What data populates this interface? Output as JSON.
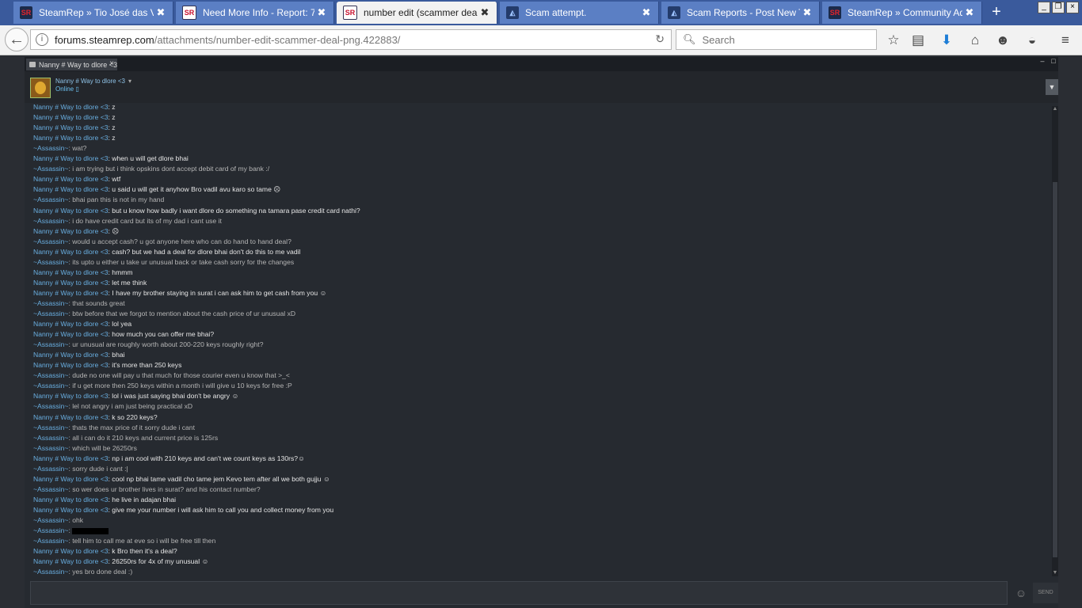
{
  "browser": {
    "tabs": [
      {
        "label": "SteamRep » Tio José das Va...",
        "icon": "steamrep-icon"
      },
      {
        "label": "Need More Info - Report: 76...",
        "icon": "steamrep-bordered-icon"
      },
      {
        "label": "number edit (scammer deal)....",
        "icon": "steamrep-bordered-icon",
        "active": true
      },
      {
        "label": "Scam attempt.",
        "icon": "forum-icon"
      },
      {
        "label": "Scam Reports - Post New Th...",
        "icon": "forum-icon"
      },
      {
        "label": "SteamRep » Community Ad...",
        "icon": "steamrep-icon"
      }
    ],
    "url_host": "forums.steamrep.com",
    "url_path": "/attachments/number-edit-scammer-deal-png.422883/",
    "search_placeholder": "Search",
    "tab_close": "✖",
    "new_tab": "+"
  },
  "chat": {
    "tab_title": "Nanny # Way to dlore <3",
    "tab_close": "×",
    "friend_name": "Nanny # Way to dlore <3",
    "friend_status": "Online",
    "send_label": "SEND",
    "messages": [
      {
        "who": "Nanny # Way to dlore <3",
        "text": "z",
        "side": "nanny"
      },
      {
        "who": "Nanny # Way to dlore <3",
        "text": "z",
        "side": "nanny"
      },
      {
        "who": "Nanny # Way to dlore <3",
        "text": "z",
        "side": "nanny"
      },
      {
        "who": "Nanny # Way to dlore <3",
        "text": "z",
        "side": "nanny"
      },
      {
        "who": "~Assassin~",
        "text": "wat?",
        "side": "assassin"
      },
      {
        "who": "Nanny # Way to dlore <3",
        "text": "when u will get dlore bhai",
        "side": "nanny"
      },
      {
        "who": "~Assassin~",
        "text": "i am trying but i think opskins dont accept debit card of my bank :/",
        "side": "assassin"
      },
      {
        "who": "Nanny # Way to dlore <3",
        "text": "wtf",
        "side": "nanny"
      },
      {
        "who": "Nanny # Way to dlore <3",
        "text": "u said u will get it anyhow Bro vadil avu karo so tame ☹",
        "side": "nanny"
      },
      {
        "who": "~Assassin~",
        "text": "bhai pan this is not in my hand",
        "side": "assassin"
      },
      {
        "who": "Nanny # Way to dlore <3",
        "text": "but u know how badly i want dlore do something na tamara pase credit card nathi?",
        "side": "nanny"
      },
      {
        "who": "~Assassin~",
        "text": "i do have credit card but its of my dad i cant use it",
        "side": "assassin"
      },
      {
        "who": "Nanny # Way to dlore <3",
        "text": "☹",
        "side": "nanny"
      },
      {
        "who": "~Assassin~",
        "text": "would u accept cash? u got anyone here who can do hand to hand deal?",
        "side": "assassin"
      },
      {
        "who": "Nanny # Way to dlore <3",
        "text": "cash? but we had a deal for dlore bhai don't do this to me vadil",
        "side": "nanny"
      },
      {
        "who": "~Assassin~",
        "text": "its upto u either u take ur unusual back or take cash sorry for the changes",
        "side": "assassin"
      },
      {
        "who": "Nanny # Way to dlore <3",
        "text": "hmmm",
        "side": "nanny"
      },
      {
        "who": "Nanny # Way to dlore <3",
        "text": "let me think",
        "side": "nanny"
      },
      {
        "who": "Nanny # Way to dlore <3",
        "text": "I have my brother staying in surat i can ask him to get cash from you ☺",
        "side": "nanny"
      },
      {
        "who": "~Assassin~",
        "text": "that sounds great",
        "side": "assassin"
      },
      {
        "who": "~Assassin~",
        "text": "btw before that we forgot to mention about the cash price of ur unusual xD",
        "side": "assassin"
      },
      {
        "who": "Nanny # Way to dlore <3",
        "text": "lol yea",
        "side": "nanny"
      },
      {
        "who": "Nanny # Way to dlore <3",
        "text": "how much you can offer me bhai?",
        "side": "nanny"
      },
      {
        "who": "~Assassin~",
        "text": "ur unusual are roughly worth about 200-220 keys roughly right?",
        "side": "assassin"
      },
      {
        "who": "Nanny # Way to dlore <3",
        "text": "bhai",
        "side": "nanny"
      },
      {
        "who": "Nanny # Way to dlore <3",
        "text": "it's more than 250 keys",
        "side": "nanny"
      },
      {
        "who": "~Assassin~",
        "text": "dude no one will pay u that much for those courier even u know that >_<",
        "side": "assassin"
      },
      {
        "who": "~Assassin~",
        "text": "if u get more then 250 keys within a month i will give u 10 keys for free :P",
        "side": "assassin"
      },
      {
        "who": "Nanny # Way to dlore <3",
        "text": "lol i was just saying bhai don't be angry ☺",
        "side": "nanny"
      },
      {
        "who": "~Assassin~",
        "text": "lel not angry i am just being practical xD",
        "side": "assassin"
      },
      {
        "who": "Nanny # Way to dlore <3",
        "text": "k so 220 keys?",
        "side": "nanny"
      },
      {
        "who": "~Assassin~",
        "text": "thats the max price of it sorry dude i cant",
        "side": "assassin"
      },
      {
        "who": "~Assassin~",
        "text": "all i can do it 210 keys and current price is 125rs",
        "side": "assassin"
      },
      {
        "who": "~Assassin~",
        "text": "which will be 26250rs",
        "side": "assassin"
      },
      {
        "who": "Nanny # Way to dlore <3",
        "text": "np i am cool with 210 keys and can't we count keys as 130rs?☺",
        "side": "nanny"
      },
      {
        "who": "~Assassin~",
        "text": "sorry dude i cant :|",
        "side": "assassin"
      },
      {
        "who": "Nanny # Way to dlore <3",
        "text": "cool np bhai tame vadil cho tame jem Kevo tem after all we both gujju ☺",
        "side": "nanny"
      },
      {
        "who": "~Assassin~",
        "text": "so wer does ur brother lives in surat? and his contact number?",
        "side": "assassin"
      },
      {
        "who": "Nanny # Way to dlore <3",
        "text": "he live in adajan bhai",
        "side": "nanny"
      },
      {
        "who": "Nanny # Way to dlore <3",
        "text": "give me your number i will ask him to call you and collect money from you",
        "side": "nanny"
      },
      {
        "who": "~Assassin~",
        "text": "ohk",
        "side": "assassin"
      },
      {
        "who": "~Assassin~",
        "text": "",
        "side": "assassin",
        "redacted": true
      },
      {
        "who": "~Assassin~",
        "text": "tell him to call me at eve so i will be free till then",
        "side": "assassin"
      },
      {
        "who": "Nanny # Way to dlore <3",
        "text": "k Bro then it's a deal?",
        "side": "nanny"
      },
      {
        "who": "Nanny # Way to dlore <3",
        "text": "26250rs for 4x of my unusual ☺",
        "side": "nanny"
      },
      {
        "who": "~Assassin~",
        "text": "yes bro done deal :)",
        "side": "assassin"
      }
    ]
  }
}
